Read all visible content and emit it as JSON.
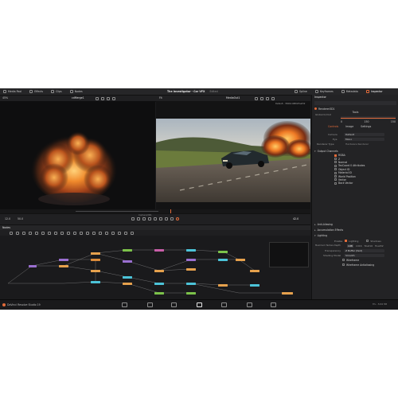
{
  "topbar": {
    "items": [
      {
        "label": "Media Pool",
        "icon": "media-pool-icon"
      },
      {
        "label": "Effects",
        "icon": "effects-icon"
      },
      {
        "label": "Clips",
        "icon": "clips-icon"
      },
      {
        "label": "Nodes",
        "icon": "nodes-icon"
      }
    ],
    "title": "The Investigator - Car VFX",
    "title_suffix": "Edited",
    "right_items": [
      {
        "label": "Spline",
        "icon": "spline-icon"
      },
      {
        "label": "Keyframes",
        "icon": "keyframes-icon"
      },
      {
        "label": "Metadata",
        "icon": "metadata-icon"
      },
      {
        "label": "Inspector",
        "icon": "inspector-icon"
      }
    ]
  },
  "viewer_left": {
    "zoom": "45%",
    "name": "cdMerge1"
  },
  "viewer_right": {
    "zoom": "Fit",
    "name": "MediaOut1",
    "overlay": "Default - 3840x1980xfloat32"
  },
  "transport": {
    "start": "12.0",
    "end": "50.0",
    "current": "42.0",
    "viewer_label": "Camera3D1"
  },
  "nodes": {
    "panel_title": "Nodes"
  },
  "inspector": {
    "title": "Inspector",
    "tab": "Tools",
    "node_name": "Renderer3D1",
    "global_in_out_label": "Global In/Out",
    "range_values": [
      "0",
      "150",
      "150"
    ],
    "tabs": [
      "Controls",
      "Image",
      "Settings"
    ],
    "rows": [
      {
        "label": "Camera",
        "value": "Default"
      },
      {
        "label": "Eye",
        "value": "Mono"
      },
      {
        "label": "Renderer Type",
        "value": "Hardware Renderer"
      }
    ],
    "output_channels_label": "Output Channels",
    "channels": [
      {
        "label": "RGBA",
        "on": true
      },
      {
        "label": "Z",
        "on": false
      },
      {
        "label": "Normal",
        "on": false
      },
      {
        "label": "TexCoord 0 Attributes",
        "on": false
      },
      {
        "label": "Object ID",
        "on": false
      },
      {
        "label": "Material ID",
        "on": false
      },
      {
        "label": "World Position",
        "on": false
      },
      {
        "label": "Vector",
        "on": false
      },
      {
        "label": "Back Vector",
        "on": false
      }
    ],
    "anti_aliasing": "Anti-Aliasing",
    "accumulation": "Accumulation Effects",
    "lighting": "Lighting",
    "enable_label": "Enable",
    "lighting_opt": "Lighting",
    "shadows_opt": "Shadows",
    "max_texture_label": "Maximum Texture Depth",
    "depth_opts": [
      "int8",
      "int16",
      "float16",
      "float32"
    ],
    "transparency_label": "Transparency",
    "transparency_val": "Z Buffer (fast)",
    "shading_label": "Shading Model",
    "shading_val": "Smooth",
    "wireframe": "Wireframe",
    "wireframe_aa": "Wireframe Antialiasing"
  },
  "bottombar": {
    "app_name": "DaVinci Resolve Studio 19",
    "status": "8% - 5202 MB"
  },
  "colors": {
    "accent": "#e26b3a",
    "panel": "#1b1b1d",
    "node_purple": "#9a6fd0",
    "node_orange": "#e6a14d",
    "node_cyan": "#4cc3d8",
    "node_green": "#7cc24a"
  }
}
